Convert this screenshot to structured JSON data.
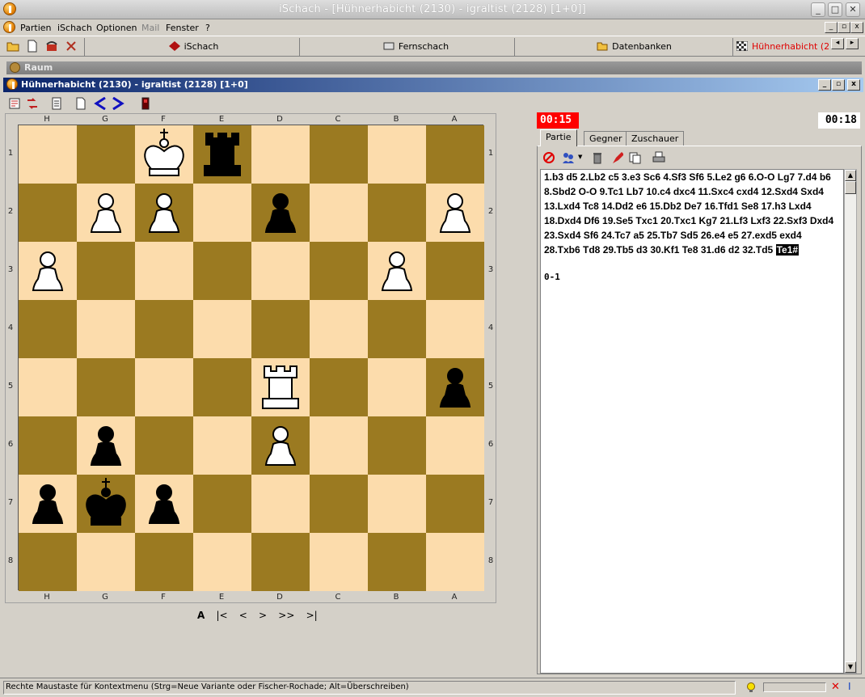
{
  "window": {
    "title": "iSchach - [Hühnerhabicht (2130) - igraltist (2128)   [1+0]]"
  },
  "menubar": {
    "items": [
      "Partien",
      "iSchach",
      "Optionen",
      "Mail",
      "Fenster",
      "?"
    ],
    "disabled": [
      "Mail"
    ]
  },
  "toolbar": {
    "tabs": [
      "iSchach",
      "Fernschach",
      "Datenbanken",
      "Hühnerhabicht (213"
    ]
  },
  "raum": {
    "label": "Raum"
  },
  "game_window": {
    "title": "Hühnerhabicht (2130) - igraltist (2128)   [1+0]"
  },
  "board": {
    "files": [
      "H",
      "G",
      "F",
      "E",
      "D",
      "C",
      "B",
      "A"
    ],
    "ranks": [
      "1",
      "2",
      "3",
      "4",
      "5",
      "6",
      "7",
      "8"
    ],
    "pieces": [
      {
        "sq": "F1",
        "type": "king",
        "color": "white"
      },
      {
        "sq": "E1",
        "type": "rook",
        "color": "black"
      },
      {
        "sq": "G2",
        "type": "pawn",
        "color": "white"
      },
      {
        "sq": "F2",
        "type": "pawn",
        "color": "white"
      },
      {
        "sq": "D2",
        "type": "pawn",
        "color": "black"
      },
      {
        "sq": "A2",
        "type": "pawn",
        "color": "white"
      },
      {
        "sq": "H3",
        "type": "pawn",
        "color": "white"
      },
      {
        "sq": "B3",
        "type": "pawn",
        "color": "white"
      },
      {
        "sq": "D5",
        "type": "rook",
        "color": "white"
      },
      {
        "sq": "A5",
        "type": "pawn",
        "color": "black"
      },
      {
        "sq": "G6",
        "type": "pawn",
        "color": "black"
      },
      {
        "sq": "D6",
        "type": "pawn",
        "color": "white"
      },
      {
        "sq": "H7",
        "type": "pawn",
        "color": "black"
      },
      {
        "sq": "G7",
        "type": "king",
        "color": "black"
      },
      {
        "sq": "F7",
        "type": "pawn",
        "color": "black"
      }
    ]
  },
  "navigation": {
    "buttons": [
      "A",
      "|<",
      "<",
      ">",
      ">>",
      ">|"
    ]
  },
  "clocks": {
    "left": "00:15",
    "right": "00:18"
  },
  "panel": {
    "tabs": [
      "Partie",
      "Gegner",
      "Zuschauer"
    ],
    "active_tab": "Partie",
    "moves": "1.b3 d5 2.Lb2 c5 3.e3 Sc6 4.Sf3 Sf6 5.Le2 g6 6.O-O Lg7 7.d4 b6 8.Sbd2 O-O 9.Tc1 Lb7 10.c4 dxc4 11.Sxc4 cxd4 12.Sxd4 Sxd4 13.Lxd4 Tc8 14.Dd2 e6 15.Db2 De7 16.Tfd1 Se8 17.h3 Lxd4 18.Dxd4 Df6 19.Se5 Txc1 20.Txc1 Kg7 21.Lf3 Lxf3 22.Sxf3 Dxd4 23.Sxd4 Sf6 24.Tc7 a5 25.Tb7 Sd5 26.e4 e5 27.exd5 exd4 28.Txb6 Td8 29.Tb5 d3 30.Kf1 Te8 31.d6 d2 32.Td5",
    "last_move": "Te1#",
    "result": "0-1"
  },
  "status": {
    "text": "Rechte Maustaste für Kontextmenu (Strg=Neue Variante oder Fischer-Rochade; Alt=Überschreiben)"
  },
  "colors": {
    "light_square": "#fcdcac",
    "dark_square": "#9b7a21",
    "title_active": "#0a246a",
    "clock_alert": "#ff0000"
  }
}
